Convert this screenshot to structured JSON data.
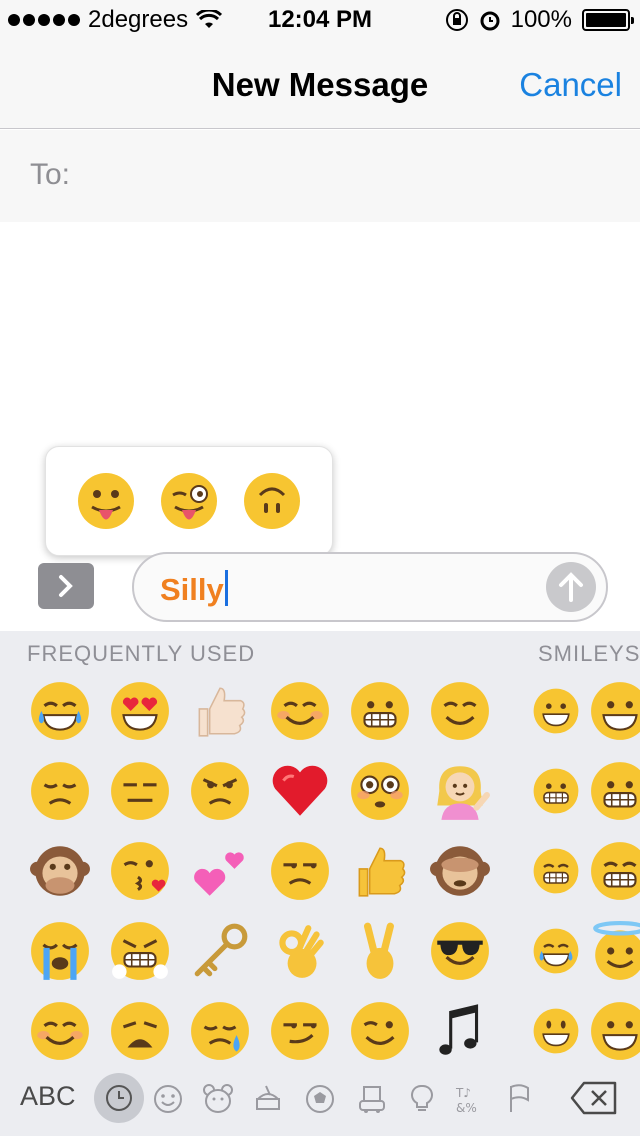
{
  "status_bar": {
    "carrier": "2degrees",
    "time": "12:04 PM",
    "battery": "100%",
    "battery_level": 1.0
  },
  "nav": {
    "title": "New Message",
    "cancel_label": "Cancel"
  },
  "to_field": {
    "label": "To:"
  },
  "suggestions": [
    "tongue-out-emoji",
    "winking-tongue-emoji",
    "upside-down-face-emoji"
  ],
  "input": {
    "value": "Silly"
  },
  "keyboard": {
    "section_frequently_used": "FREQUENTLY USED",
    "section_smileys": "SMILEYS",
    "abc_label": "ABC",
    "categories": [
      "recent-clock-icon",
      "smiley-icon",
      "animal-icon",
      "food-icon",
      "sports-ball-icon",
      "buildings-icon",
      "lightbulb-icon",
      "symbols-icon",
      "flag-icon"
    ],
    "active_category": "recent-clock-icon",
    "emoji_rows": [
      [
        "tears-of-joy",
        "heart-eyes",
        "thumbs-up-light",
        "blush-smile",
        "grimace",
        "relieved",
        "grinning",
        "grinning-partial"
      ],
      [
        "pensive",
        "expressionless",
        "angry",
        "red-heart",
        "flushed",
        "information-desk-person",
        "grimacing",
        "grimacing-partial"
      ],
      [
        "speak-no-evil-monkey",
        "kissing-heart",
        "two-hearts",
        "unamused",
        "thumbs-up",
        "see-no-evil-monkey",
        "beaming",
        "beaming-partial"
      ],
      [
        "loudly-crying",
        "triumph",
        "old-key",
        "ok-hand",
        "victory-hand",
        "sunglasses",
        "tears-of-joy",
        "halo-partial"
      ],
      [
        "relaxed",
        "weary",
        "sleepy",
        "smirk",
        "wink",
        "musical-notes",
        "smiley",
        "smiley-partial"
      ]
    ]
  },
  "colors": {
    "accent": "#1a82e0",
    "input_text": "#f08020",
    "keyboard_bg": "#ecedf1",
    "emoji_face": "#f7c531"
  }
}
